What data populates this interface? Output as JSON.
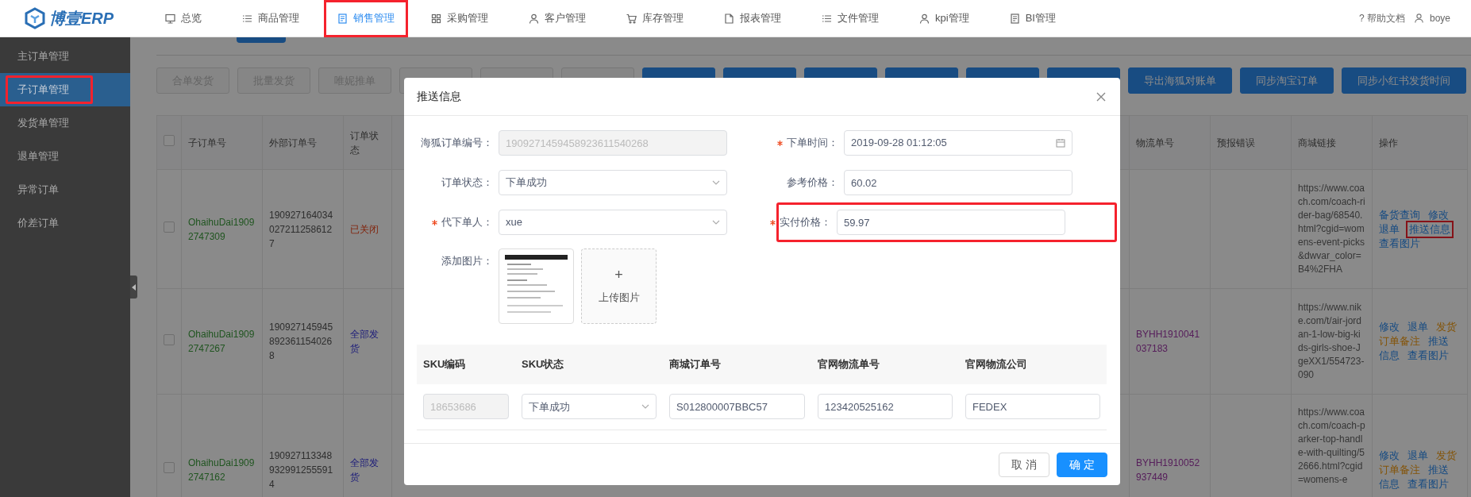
{
  "logo": {
    "text": "博壹ERP"
  },
  "nav": [
    {
      "label": "总览",
      "selected": false,
      "annotated": false
    },
    {
      "label": "商品管理",
      "selected": false,
      "annotated": false
    },
    {
      "label": "销售管理",
      "selected": true,
      "annotated": true
    },
    {
      "label": "采购管理",
      "selected": false,
      "annotated": false
    },
    {
      "label": "客户管理",
      "selected": false,
      "annotated": false
    },
    {
      "label": "库存管理",
      "selected": false,
      "annotated": false
    },
    {
      "label": "报表管理",
      "selected": false,
      "annotated": false
    },
    {
      "label": "文件管理",
      "selected": false,
      "annotated": false
    },
    {
      "label": "kpi管理",
      "selected": false,
      "annotated": false
    },
    {
      "label": "BI管理",
      "selected": false,
      "annotated": false
    }
  ],
  "header_links": {
    "help": "? 帮助文档",
    "user": "boye"
  },
  "sidebar": {
    "items": [
      {
        "label": "主订单管理",
        "selected": false,
        "annotated": false
      },
      {
        "label": "子订单管理",
        "selected": true,
        "annotated": true
      },
      {
        "label": "发货单管理",
        "selected": false,
        "annotated": false
      },
      {
        "label": "退单管理",
        "selected": false,
        "annotated": false
      },
      {
        "label": "异常订单",
        "selected": false,
        "annotated": false
      },
      {
        "label": "价差订单",
        "selected": false,
        "annotated": false
      }
    ]
  },
  "toolbar": {
    "buttons": [
      {
        "label": "合单发货",
        "disabled": true
      },
      {
        "label": "批量发货",
        "disabled": true
      },
      {
        "label": "唯妮推单",
        "disabled": true
      },
      {
        "disabled": true
      },
      {
        "disabled": true
      },
      {
        "disabled": true
      },
      {
        "disabled": false
      },
      {
        "disabled": false
      },
      {
        "disabled": false
      },
      {
        "disabled": false
      },
      {
        "disabled": false
      },
      {
        "disabled": false
      },
      {
        "label": "导出海狐对账单",
        "disabled": false
      },
      {
        "label": "同步淘宝订单",
        "disabled": false
      },
      {
        "label": "同步小红书发货时间",
        "disabled": false
      }
    ]
  },
  "table": {
    "header_checked": false,
    "left_columns": [
      "子订单号",
      "外部订单号",
      "订单状态"
    ],
    "right_columns": [
      "物流单号",
      "预报错误",
      "商城链接",
      "操作"
    ],
    "rows": [
      {
        "checked": false,
        "sub_order": "OhaihuDai19092747309",
        "external_order": "1909271640340272112586127",
        "status": {
          "text": "已关闭",
          "kind": "closed"
        },
        "mall_link": "https://www.coach.com/coach-rider-bag/68540.html?cgid=womens-event-picks&dwvar_color=B4%2FHA",
        "actions": [
          [
            {
              "label": "备货查询",
              "kind": "primary",
              "annotated": false
            },
            {
              "label": "修改",
              "kind": "primary",
              "annotated": false
            }
          ],
          [
            {
              "label": "退单",
              "kind": "primary",
              "annotated": false
            },
            {
              "label": "推送信息",
              "kind": "primary",
              "annotated": true
            }
          ],
          [
            {
              "label": "查看图片",
              "kind": "primary",
              "annotated": false
            }
          ]
        ]
      },
      {
        "checked": false,
        "sub_order": "OhaihuDai19092747267",
        "external_order": "1909271459458923611540268",
        "status": {
          "text": "全部发货",
          "kind": "shipped"
        },
        "tracking": "BYHH1910041037183",
        "mall_link": "https://www.nike.com/t/air-jordan-1-low-big-kids-girls-shoe-JgeXX1/554723-090",
        "actions": [
          [
            {
              "label": "修改",
              "kind": "primary",
              "annotated": false
            },
            {
              "label": "退单",
              "kind": "primary",
              "annotated": false
            },
            {
              "label": "发货",
              "kind": "warning",
              "annotated": false
            }
          ],
          [
            {
              "label": "订单备注",
              "kind": "warning",
              "annotated": false
            },
            {
              "label": "推送",
              "kind": "primary",
              "annotated": false
            }
          ],
          [
            {
              "label": "信息",
              "kind": "primary",
              "annotated": false
            },
            {
              "label": "查看图片",
              "kind": "primary",
              "annotated": false
            }
          ]
        ]
      },
      {
        "checked": false,
        "sub_order": "OhaihuDai19092747162",
        "external_order": "1909271133489329912555914",
        "status": {
          "text": "全部发货",
          "kind": "shipped"
        },
        "tracking": "BYHH1910052937449",
        "mall_link": "https://www.coach.com/coach-parker-top-handle-with-quilting/52666.html?cgid=womens-e",
        "actions": [
          [
            {
              "label": "修改",
              "kind": "primary",
              "annotated": false
            },
            {
              "label": "退单",
              "kind": "primary",
              "annotated": false
            },
            {
              "label": "发货",
              "kind": "warning",
              "annotated": false
            }
          ],
          [
            {
              "label": "订单备注",
              "kind": "warning",
              "annotated": false
            },
            {
              "label": "推送",
              "kind": "primary",
              "annotated": false
            }
          ],
          [
            {
              "label": "信息",
              "kind": "primary",
              "annotated": false
            },
            {
              "label": "查看图片",
              "kind": "primary",
              "annotated": false
            }
          ]
        ]
      }
    ]
  },
  "dialog": {
    "title": "推送信息",
    "fields": [
      {
        "label": "海狐订单编号：",
        "kind": "text",
        "value": "1909271459458923611540268",
        "required": false,
        "disabled": true,
        "annotated": false
      },
      {
        "label": "下单时间：",
        "kind": "date",
        "value": "2019-09-28 01:12:05",
        "required": true,
        "disabled": false,
        "annotated": false
      },
      {
        "label": "订单状态：",
        "kind": "select",
        "value": "下单成功",
        "required": false,
        "disabled": false,
        "annotated": false
      },
      {
        "label": "参考价格：",
        "kind": "text",
        "value": "60.02",
        "required": false,
        "disabled": false,
        "annotated": false
      },
      {
        "label": "代下单人：",
        "kind": "select",
        "value": "xue",
        "required": true,
        "disabled": false,
        "annotated": false
      },
      {
        "label": "实付价格：",
        "kind": "text",
        "value": "59.97",
        "required": true,
        "disabled": false,
        "annotated": true
      }
    ],
    "image_field": {
      "label": "添加图片：",
      "upload_mark": "+",
      "upload_label": "上传图片"
    },
    "sku_table": {
      "columns": [
        "SKU编码",
        "SKU状态",
        "商城订单号",
        "官网物流单号",
        "官网物流公司"
      ],
      "rows": [
        {
          "cells": [
            {
              "kind": "text",
              "value": "18653686",
              "disabled": true
            },
            {
              "kind": "select",
              "value": "下单成功",
              "disabled": false
            },
            {
              "kind": "text",
              "value": "S012800007BBC57",
              "disabled": false
            },
            {
              "kind": "text",
              "value": "123420525162",
              "disabled": false
            },
            {
              "kind": "text",
              "value": "FEDEX",
              "disabled": false
            }
          ]
        }
      ]
    },
    "buttons": [
      {
        "label": "取 消",
        "kind": "secondary"
      },
      {
        "label": "确 定",
        "kind": "primary"
      }
    ]
  }
}
